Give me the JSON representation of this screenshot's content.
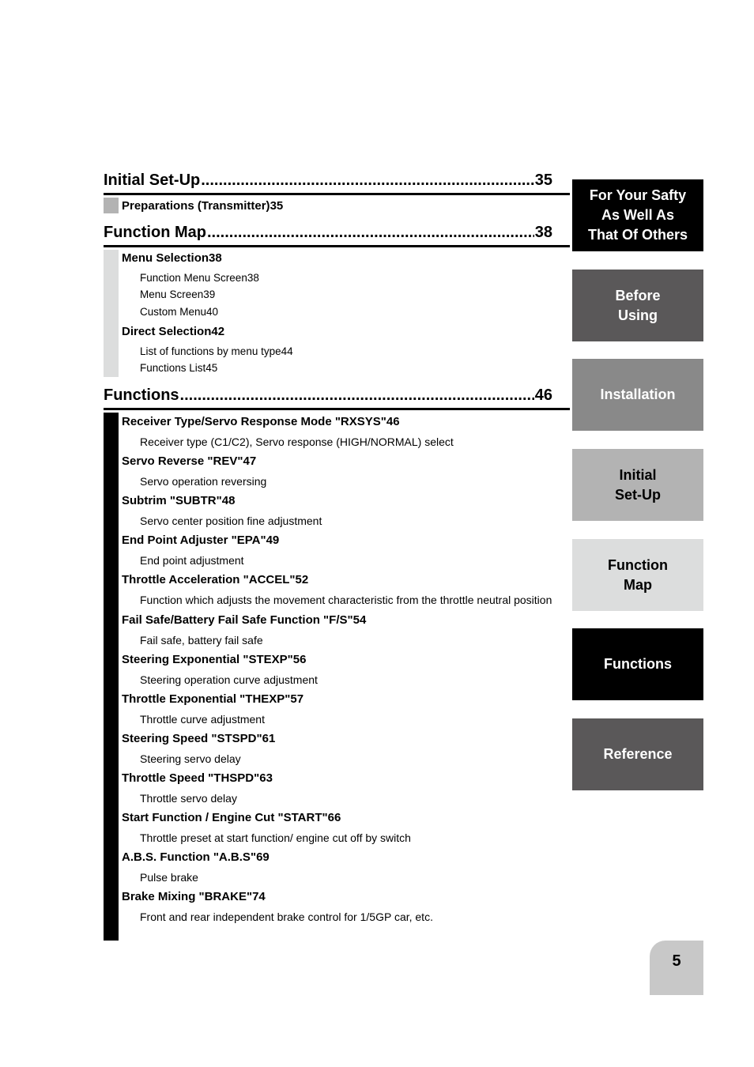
{
  "colors": {
    "text": "#000000",
    "rule": "#000000",
    "bar_initial_setup": "#b3b3b3",
    "bar_function_map": "#dcdddd",
    "bar_functions": "#000000",
    "tab_safety_bg": "#000000",
    "tab_before_bg": "#5a5859",
    "tab_install_bg": "#898989",
    "tab_initial_bg": "#b3b3b3",
    "tab_map_bg": "#dcdddd",
    "tab_functions_bg": "#000000",
    "tab_reference_bg": "#5a5859",
    "page_num_bg": "#c8c8c8"
  },
  "sections": [
    {
      "title": "Initial Set-Up",
      "page": "35",
      "entries": [
        {
          "title": "Preparations (Transmitter)",
          "page": "35"
        }
      ]
    },
    {
      "title": "Function Map",
      "page": "38",
      "entries": [
        {
          "title": "Menu Selection",
          "page": "38",
          "subs": [
            {
              "title": "Function Menu Screen",
              "page": "38"
            },
            {
              "title": "Menu Screen",
              "page": "39"
            },
            {
              "title": "Custom Menu",
              "page": "40"
            }
          ]
        },
        {
          "title": "Direct Selection",
          "page": "42",
          "subs": [
            {
              "title": "List of functions by menu type",
              "page": "44"
            },
            {
              "title": "Functions List",
              "page": "45"
            }
          ]
        }
      ]
    },
    {
      "title": "Functions",
      "page": "46",
      "entries": [
        {
          "title": "Receiver Type/Servo Response Mode  \"RXSYS\"",
          "page": "46",
          "desc": "Receiver type (C1/C2), Servo response (HIGH/NORMAL) select"
        },
        {
          "title": "Servo Reverse \"REV\"",
          "page": "47",
          "desc": "Servo operation reversing"
        },
        {
          "title": "Subtrim  \"SUBTR\"",
          "page": "48",
          "desc": "Servo center position fine adjustment"
        },
        {
          "title": "End Point Adjuster  \"EPA\"",
          "page": "49",
          "desc": "End point adjustment"
        },
        {
          "title": "Throttle Acceleration  \"ACCEL\"",
          "page": "52",
          "desc": "Function which adjusts the movement characteristic from the throttle neutral position"
        },
        {
          "title": "Fail Safe/Battery Fail Safe Function  \"F/S\"",
          "page": "54",
          "desc": "Fail safe, battery fail safe"
        },
        {
          "title": "Steering Exponential  \"STEXP\"",
          "page": "56",
          "desc": "Steering operation curve adjustment"
        },
        {
          "title": "Throttle Exponential  \"THEXP\"",
          "page": "57",
          "desc": "Throttle curve adjustment"
        },
        {
          "title": "Steering Speed  \"STSPD\"",
          "page": "61",
          "desc": "Steering servo delay"
        },
        {
          "title": "Throttle Speed  \"THSPD\"",
          "page": "63",
          "desc": "Throttle servo delay"
        },
        {
          "title": "Start Function / Engine Cut  \"START\"",
          "page": "66",
          "desc": "Throttle preset at start function/ engine cut off by switch"
        },
        {
          "title": "A.B.S. Function  \"A.B.S\"",
          "page": "69",
          "desc": "Pulse brake"
        },
        {
          "title": "Brake Mixing  \"BRAKE\"",
          "page": "74",
          "desc": "Front and rear independent brake control for 1/5GP car, etc."
        }
      ]
    }
  ],
  "tabs": [
    {
      "lines": [
        "For Your Safty",
        "As Well As",
        "That Of Others"
      ]
    },
    {
      "lines": [
        "Before",
        "Using"
      ]
    },
    {
      "lines": [
        "Installation"
      ]
    },
    {
      "lines": [
        "Initial",
        "Set-Up"
      ]
    },
    {
      "lines": [
        "Function",
        "Map"
      ]
    },
    {
      "lines": [
        "Functions"
      ]
    },
    {
      "lines": [
        "Reference"
      ]
    }
  ],
  "page_number": "5"
}
